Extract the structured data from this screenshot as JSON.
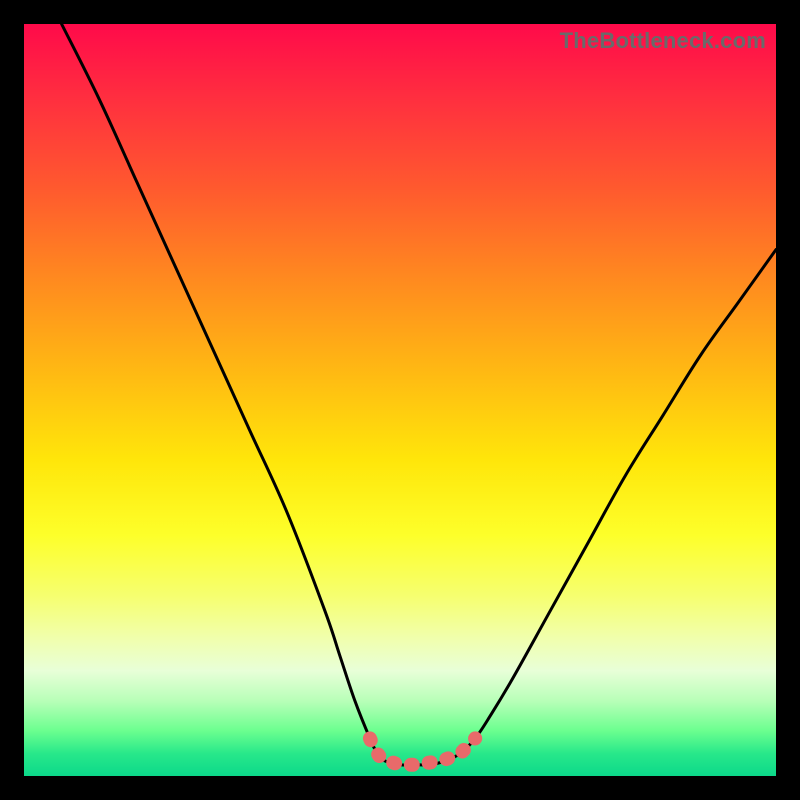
{
  "credit": "TheBottleneck.com",
  "chart_data": {
    "type": "line",
    "title": "",
    "xlabel": "",
    "ylabel": "",
    "xlim": [
      0,
      100
    ],
    "ylim": [
      0,
      100
    ],
    "series": [
      {
        "name": "curve",
        "x": [
          5,
          10,
          15,
          20,
          25,
          30,
          35,
          40,
          42,
          44,
          46,
          47,
          48,
          50,
          52,
          54,
          56,
          58,
          60,
          62,
          65,
          70,
          75,
          80,
          85,
          90,
          95,
          100
        ],
        "y": [
          100,
          90,
          79,
          68,
          57,
          46,
          35,
          22,
          16,
          10,
          5,
          3,
          2,
          1.5,
          1.5,
          1.5,
          2,
          3,
          5,
          8,
          13,
          22,
          31,
          40,
          48,
          56,
          63,
          70
        ]
      },
      {
        "name": "highlight",
        "x": [
          46,
          47,
          48,
          49,
          50,
          51,
          52,
          53,
          54,
          55,
          56,
          57,
          58,
          59,
          60
        ],
        "y": [
          5,
          3,
          2,
          1.8,
          1.5,
          1.5,
          1.5,
          1.6,
          1.8,
          2,
          2.2,
          2.6,
          3,
          4,
          5
        ]
      }
    ],
    "colors": {
      "curve": "#000000",
      "highlight": "#e86a6a"
    }
  }
}
